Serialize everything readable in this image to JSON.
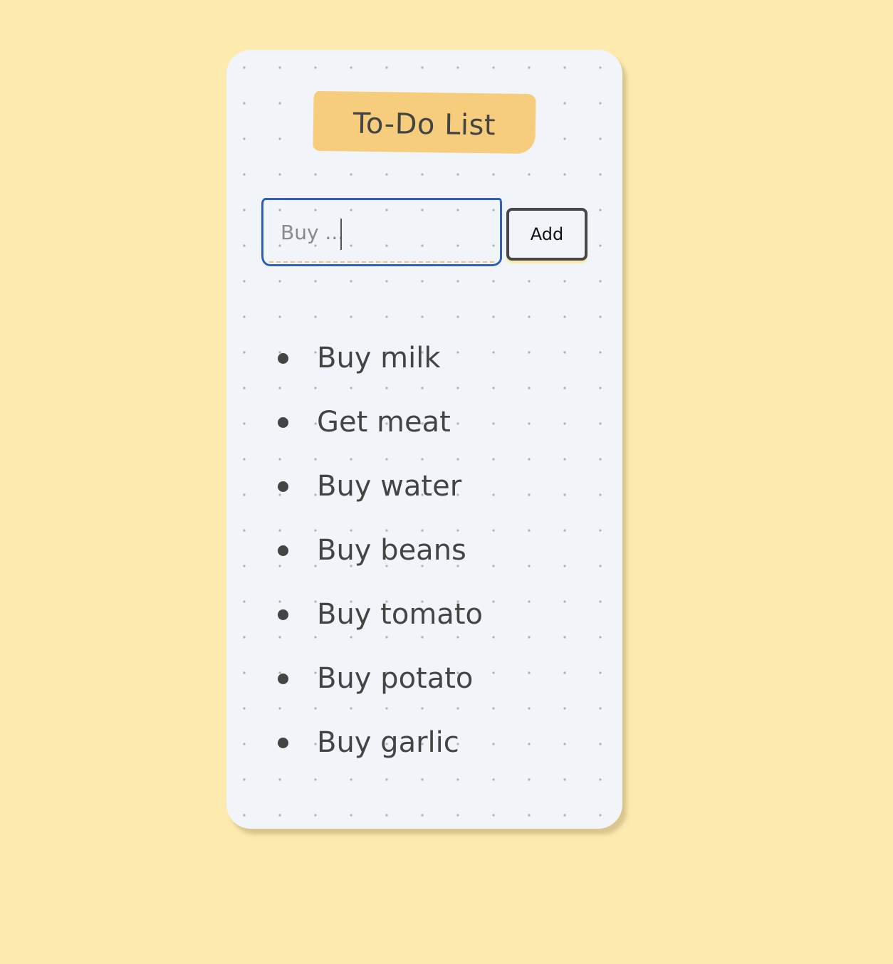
{
  "app": {
    "title": "To-Do List"
  },
  "input": {
    "placeholder": "Buy ...",
    "value": ""
  },
  "add_button": {
    "label": "Add"
  },
  "todos": [
    {
      "text": "Buy milk"
    },
    {
      "text": "Get meat"
    },
    {
      "text": "Buy water"
    },
    {
      "text": "Buy beans"
    },
    {
      "text": "Buy tomato"
    },
    {
      "text": "Buy potato"
    },
    {
      "text": "Buy garlic"
    }
  ],
  "colors": {
    "page_background": "#fdeaae",
    "card_background": "#f1f4f8",
    "title_badge": "#f6cd7c",
    "input_focus_border": "#2f5fb8",
    "text": "#444444"
  }
}
